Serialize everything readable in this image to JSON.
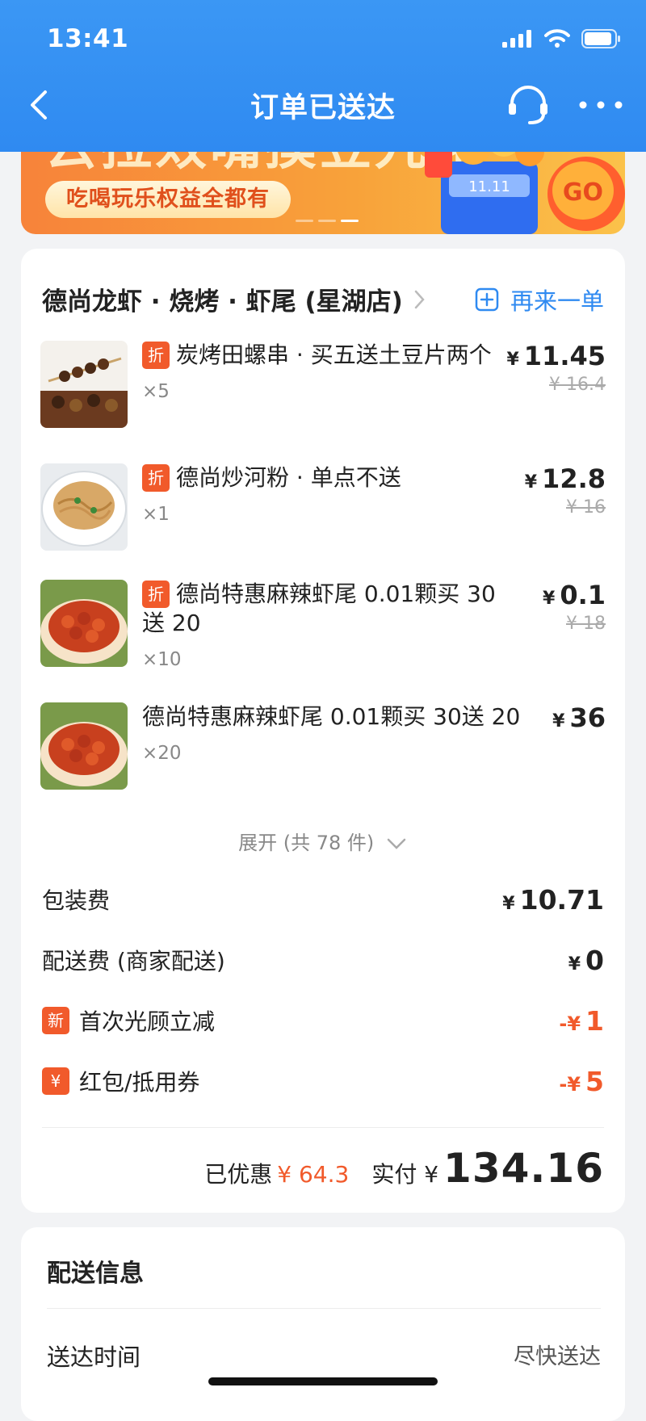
{
  "status_bar": {
    "time": "13:41"
  },
  "nav": {
    "title": "订单已送达"
  },
  "banner": {
    "headline": "云拉效嘴摸豆九花",
    "pill_text": "吃喝玩乐权益全都有"
  },
  "shop": {
    "name": "德尚龙虾 · 烧烤 · 虾尾 (星湖店)",
    "reorder_label": "再来一单"
  },
  "items": [
    {
      "discount_tag": "折",
      "name": "炭烤田螺串 · 买五送土豆片两个",
      "qty": "×5",
      "price": "11.45",
      "original_price": "¥ 16.4"
    },
    {
      "discount_tag": "折",
      "name": "德尚炒河粉 · 单点不送",
      "qty": "×1",
      "price": "12.8",
      "original_price": "¥ 16"
    },
    {
      "discount_tag": "折",
      "name": "德尚特惠麻辣虾尾 0.01颗买 30送 20",
      "qty": "×10",
      "price": "0.1",
      "original_price": "¥ 18"
    },
    {
      "discount_tag": "",
      "name": "德尚特惠麻辣虾尾 0.01颗买 30送 20",
      "qty": "×20",
      "price": "36",
      "original_price": ""
    }
  ],
  "currency": "¥",
  "discount_currency": "-¥",
  "expand_label": "展开 (共 78 件)",
  "fees": {
    "packaging_label": "包装费",
    "packaging_value": "10.71",
    "delivery_label": "配送费 (商家配送)",
    "delivery_value": "0",
    "first_visit_badge": "新",
    "first_visit_label": "首次光顾立减",
    "first_visit_value": "1",
    "coupon_badge": "¥",
    "coupon_label": "红包/抵用券",
    "coupon_value": "5"
  },
  "totals": {
    "saved_label": "已优惠",
    "saved_value": "¥ 64.3",
    "paid_label": "实付 ¥",
    "paid_value": "134.16"
  },
  "delivery": {
    "title": "配送信息",
    "time_label": "送达时间",
    "time_value": "尽快送达"
  },
  "colors": {
    "header_blue": "#2f8af1",
    "accent_red": "#f15a2b"
  }
}
